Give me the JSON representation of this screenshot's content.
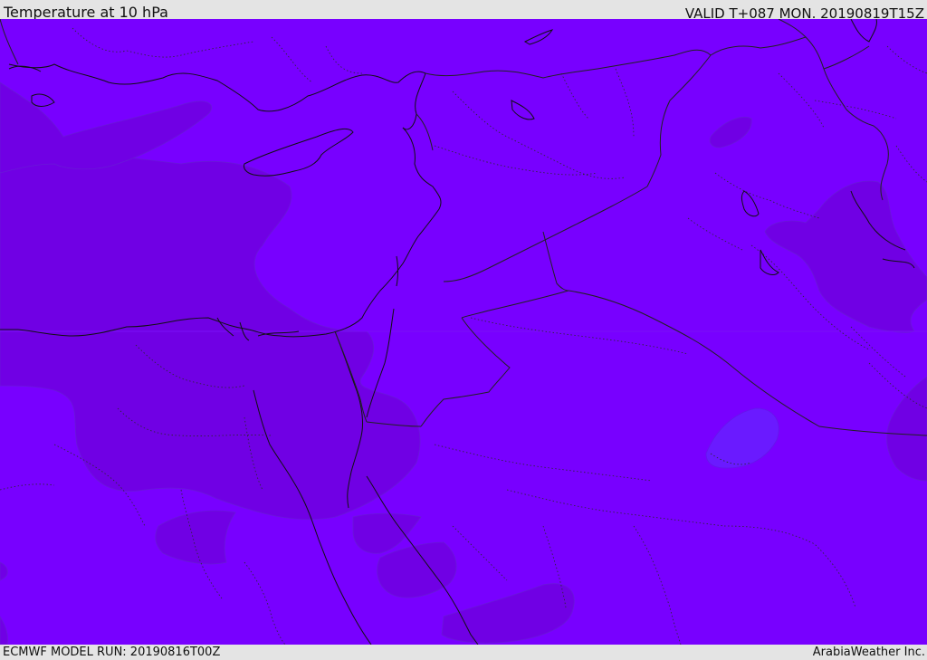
{
  "header": {
    "title": "Temperature at 10 hPa",
    "valid_time": "VALID T+087 MON. 20190819T15Z"
  },
  "footer": {
    "model_run": "ECMWF MODEL RUN: 20190816T00Z",
    "credit": "ArabiaWeather Inc."
  },
  "map": {
    "colors": {
      "base_field": "#7800ff",
      "warm_contour": "#7000e4",
      "cool_contour": "#6a1aff",
      "coastline": "#111111",
      "border": "#222222"
    }
  }
}
